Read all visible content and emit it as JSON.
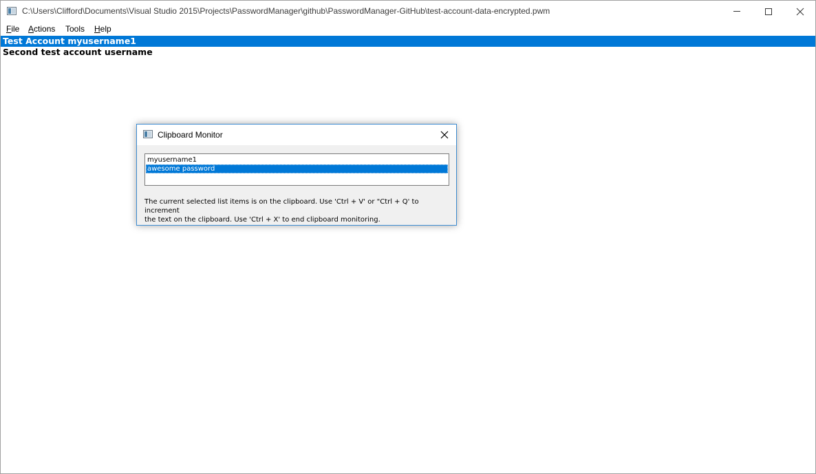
{
  "window": {
    "title": "C:\\Users\\Clifford\\Documents\\Visual Studio 2015\\Projects\\PasswordManager\\github\\PasswordManager-GitHub\\test-account-data-encrypted.pwm",
    "icon": "app-window-icon",
    "controls": {
      "minimize": "minimize-icon",
      "maximize": "maximize-icon",
      "close": "close-icon"
    }
  },
  "menu": {
    "file": {
      "mnemonic": "F",
      "rest": "ile"
    },
    "actions": {
      "mnemonic": "A",
      "rest": "ctions"
    },
    "tools": {
      "label": "Tools"
    },
    "help": {
      "mnemonic": "H",
      "rest": "elp"
    }
  },
  "accounts": [
    {
      "label": "Test Account myusername1",
      "selected": true
    },
    {
      "label": "Second test account username",
      "selected": false
    }
  ],
  "dialog": {
    "title": "Clipboard Monitor",
    "items": [
      {
        "label": "myusername1",
        "selected": false
      },
      {
        "label": "awesome password",
        "selected": true
      }
    ],
    "message_line1": "The current selected list items is on the clipboard. Use 'Ctrl + V' or \"Ctrl + Q' to increment",
    "message_line2": "the text on the clipboard. Use 'Ctrl + X' to end clipboard monitoring."
  },
  "colors": {
    "selection": "#0078d7",
    "dialog_border": "#3c8bd0",
    "dialog_bg": "#f0f0f0"
  }
}
